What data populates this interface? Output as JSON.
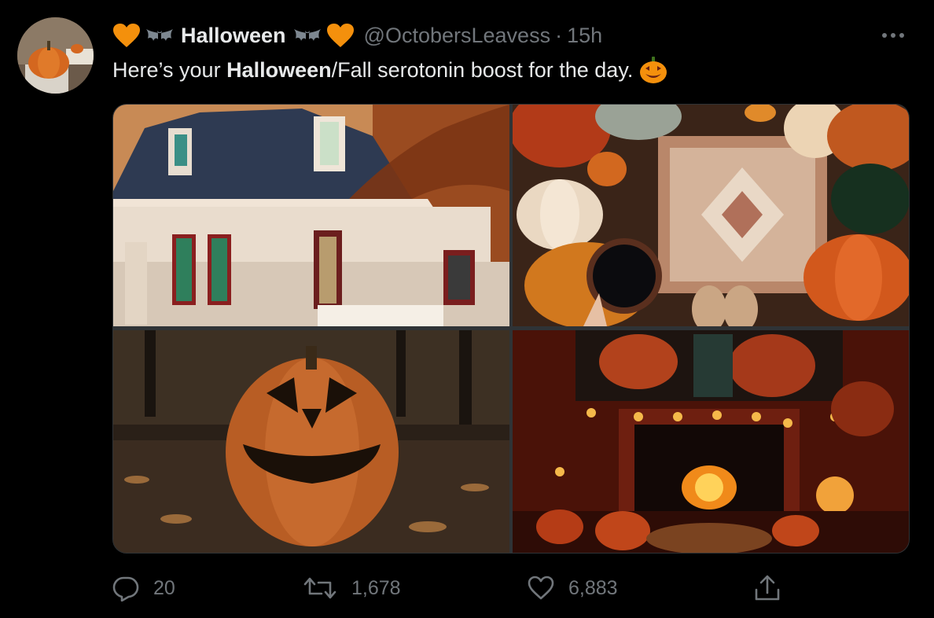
{
  "tweet": {
    "display_name": "Halloween",
    "name_emoji_left": [
      "orange-heart",
      "bat"
    ],
    "name_emoji_right": [
      "bat",
      "orange-heart"
    ],
    "handle": "@OctobersLeavess",
    "separator": "·",
    "time": "15h",
    "text_parts": {
      "before": "Here’s your ",
      "bold": "Halloween",
      "after": "/Fall serotonin boost for the day. "
    },
    "text_emoji": "jack-o-lantern"
  },
  "media": [
    {
      "subject": "victorian-house"
    },
    {
      "subject": "pumpkins-coffee-rug"
    },
    {
      "subject": "jack-o-lantern-forest"
    },
    {
      "subject": "fireplace-movie-night"
    }
  ],
  "actions": {
    "reply_count": "20",
    "retweet_count": "1,678",
    "like_count": "6,883"
  },
  "colors": {
    "background": "#000000",
    "text": "#e7e9ea",
    "secondary": "#71767b",
    "accent_orange": "#f0932b"
  }
}
